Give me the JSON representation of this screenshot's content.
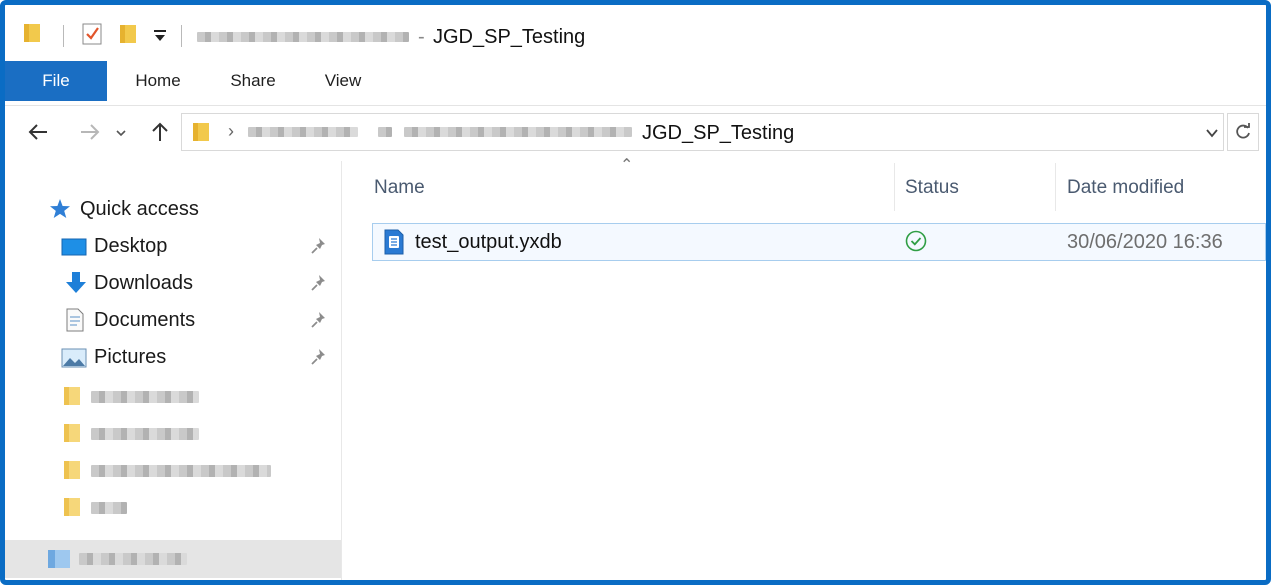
{
  "window": {
    "title": "JGD_SP_Testing",
    "title_separator": "-"
  },
  "ribbon": {
    "tabs": [
      {
        "label": "File"
      },
      {
        "label": "Home"
      },
      {
        "label": "Share"
      },
      {
        "label": "View"
      }
    ]
  },
  "address": {
    "current_folder": "JGD_SP_Testing"
  },
  "navigation": {
    "quick_access_label": "Quick access",
    "pinned": [
      {
        "label": "Desktop",
        "icon": "desktop-icon"
      },
      {
        "label": "Downloads",
        "icon": "download-arrow-icon"
      },
      {
        "label": "Documents",
        "icon": "document-icon"
      },
      {
        "label": "Pictures",
        "icon": "pictures-icon"
      }
    ]
  },
  "columns": {
    "name": "Name",
    "status": "Status",
    "date_modified": "Date modified"
  },
  "files": [
    {
      "name": "test_output.yxdb",
      "status": "synced",
      "date_modified": "30/06/2020 16:36",
      "icon": "yxdb-file-icon"
    }
  ],
  "colors": {
    "accent": "#1a6ec3",
    "frame_border": "#0a6cc4",
    "status_ok": "#2f9e44",
    "folder": "#f2c94c"
  }
}
